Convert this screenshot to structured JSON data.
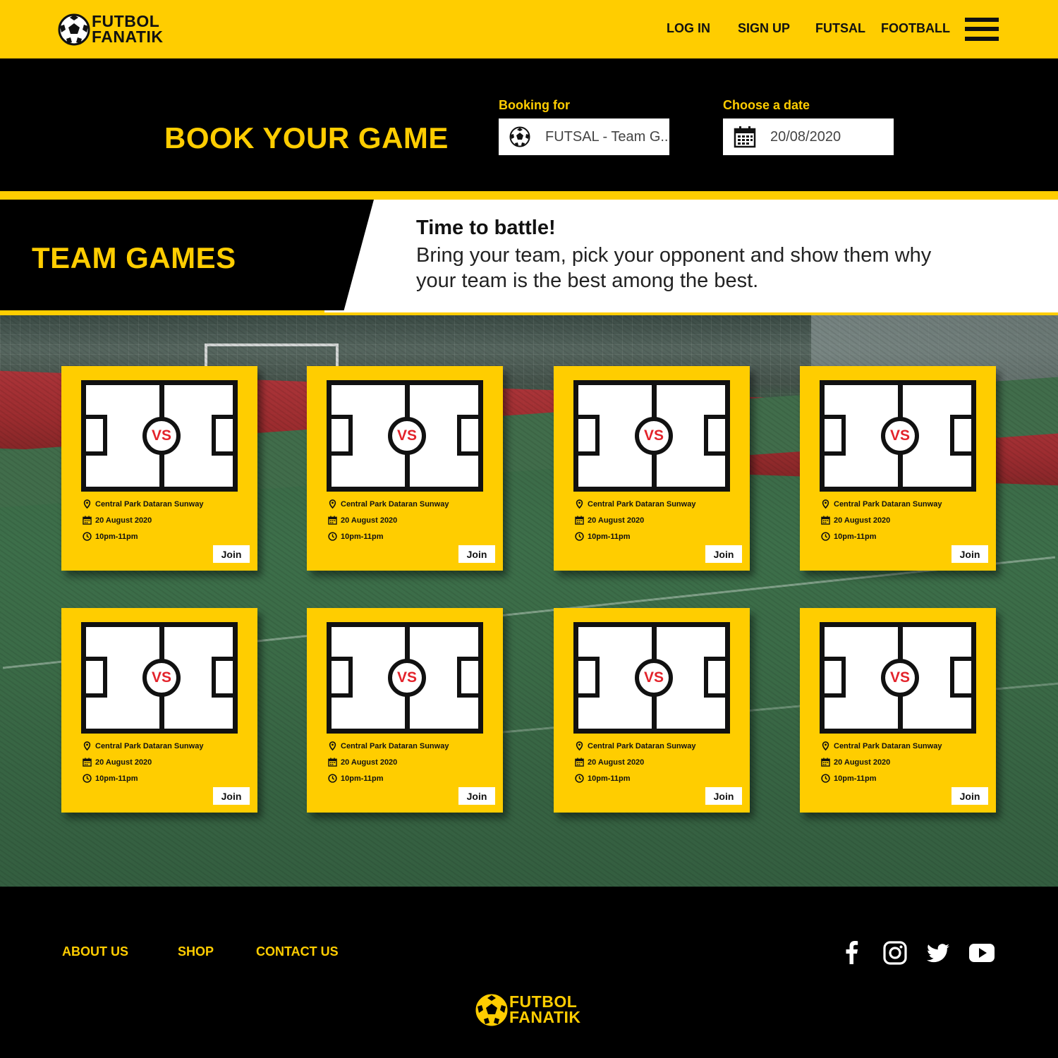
{
  "brand": {
    "line1": "FUTBOL",
    "line2": "FANATIK",
    "accent": "#ffcd00"
  },
  "nav": {
    "login": "LOG IN",
    "signup": "SIGN UP",
    "futsal": "FUTSAL",
    "football": "FOOTBALL"
  },
  "booking": {
    "title": "BOOK YOUR GAME",
    "booking_for_label": "Booking for",
    "booking_for_value": "FUTSAL - Team G..",
    "date_label": "Choose a date",
    "date_value": "20/08/2020"
  },
  "team_games": {
    "title": "TEAM GAMES",
    "heading": "Time to battle!",
    "description": "Bring your team, pick your opponent and show them why your team is the best among the best."
  },
  "games": [
    {
      "vs": "VS",
      "location": "Central Park Dataran Sunway",
      "date": "20 August 2020",
      "time": "10pm-11pm",
      "join": "Join"
    },
    {
      "vs": "VS",
      "location": "Central Park Dataran Sunway",
      "date": "20 August 2020",
      "time": "10pm-11pm",
      "join": "Join"
    },
    {
      "vs": "VS",
      "location": "Central Park Dataran Sunway",
      "date": "20 August 2020",
      "time": "10pm-11pm",
      "join": "Join"
    },
    {
      "vs": "VS",
      "location": "Central Park Dataran Sunway",
      "date": "20 August 2020",
      "time": "10pm-11pm",
      "join": "Join"
    },
    {
      "vs": "VS",
      "location": "Central Park Dataran Sunway",
      "date": "20 August 2020",
      "time": "10pm-11pm",
      "join": "Join"
    },
    {
      "vs": "VS",
      "location": "Central Park Dataran Sunway",
      "date": "20 August 2020",
      "time": "10pm-11pm",
      "join": "Join"
    },
    {
      "vs": "VS",
      "location": "Central Park Dataran Sunway",
      "date": "20 August 2020",
      "time": "10pm-11pm",
      "join": "Join"
    },
    {
      "vs": "VS",
      "location": "Central Park Dataran Sunway",
      "date": "20 August 2020",
      "time": "10pm-11pm",
      "join": "Join"
    }
  ],
  "footer": {
    "about": "ABOUT US",
    "shop": "SHOP",
    "contact": "CONTACT US",
    "social_icons": [
      "facebook-icon",
      "instagram-icon",
      "twitter-icon",
      "youtube-icon"
    ]
  }
}
